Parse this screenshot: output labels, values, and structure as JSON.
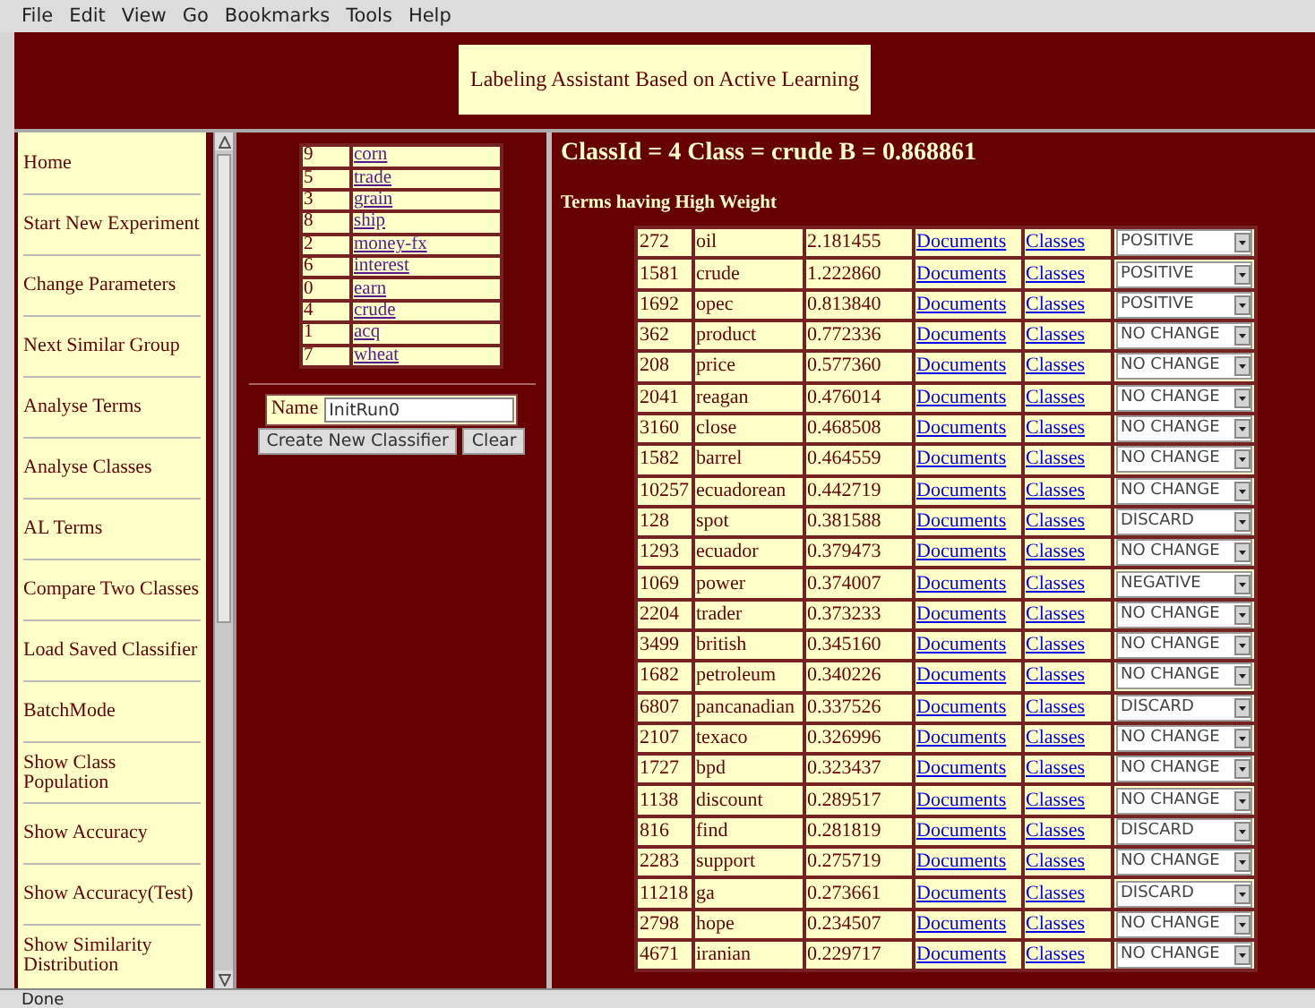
{
  "menu_bar": [
    "File",
    "Edit",
    "View",
    "Go",
    "Bookmarks",
    "Tools",
    "Help"
  ],
  "header": {
    "title": "Labeling Assistant Based on Active Learning"
  },
  "sidebar": {
    "items": [
      "Home",
      "Start New Experiment",
      "Change Parameters",
      "Next Similar Group",
      "Analyse Terms",
      "Analyse Classes",
      "AL Terms",
      "Compare Two Classes",
      "Load Saved Classifier",
      "BatchMode",
      "Show Class Population",
      "Show Accuracy",
      "Show Accuracy(Test)",
      "Show Similarity Distribution"
    ]
  },
  "classes": [
    {
      "id": "9",
      "name": "corn"
    },
    {
      "id": "5",
      "name": "trade"
    },
    {
      "id": "3",
      "name": "grain"
    },
    {
      "id": "8",
      "name": "ship"
    },
    {
      "id": "2",
      "name": "money-fx"
    },
    {
      "id": "6",
      "name": "interest"
    },
    {
      "id": "0",
      "name": "earn"
    },
    {
      "id": "4",
      "name": "crude"
    },
    {
      "id": "1",
      "name": "acq"
    },
    {
      "id": "7",
      "name": "wheat"
    }
  ],
  "classifier_form": {
    "name_label": "Name",
    "name_value": "InitRun0",
    "buttons": [
      "Create New Classifier",
      "Clear"
    ]
  },
  "heading": "ClassId = 4 Class = crude B = 0.868861",
  "subheading": "Terms having High Weight",
  "terms": [
    {
      "id": "272",
      "term": "oil",
      "weight": "2.181455",
      "documents": "Documents",
      "classes": "Classes",
      "action": "POSITIVE"
    },
    {
      "id": "1581",
      "term": "crude",
      "weight": "1.222860",
      "documents": "Documents",
      "classes": "Classes",
      "action": "POSITIVE"
    },
    {
      "id": "1692",
      "term": "opec",
      "weight": "0.813840",
      "documents": "Documents",
      "classes": "Classes",
      "action": "POSITIVE"
    },
    {
      "id": "362",
      "term": "product",
      "weight": "0.772336",
      "documents": "Documents",
      "classes": "Classes",
      "action": "NO CHANGE"
    },
    {
      "id": "208",
      "term": "price",
      "weight": "0.577360",
      "documents": "Documents",
      "classes": "Classes",
      "action": "NO CHANGE"
    },
    {
      "id": "2041",
      "term": "reagan",
      "weight": "0.476014",
      "documents": "Documents",
      "classes": "Classes",
      "action": "NO CHANGE"
    },
    {
      "id": "3160",
      "term": "close",
      "weight": "0.468508",
      "documents": "Documents",
      "classes": "Classes",
      "action": "NO CHANGE"
    },
    {
      "id": "1582",
      "term": "barrel",
      "weight": "0.464559",
      "documents": "Documents",
      "classes": "Classes",
      "action": "NO CHANGE"
    },
    {
      "id": "10257",
      "term": "ecuadorean",
      "weight": "0.442719",
      "documents": "Documents",
      "classes": "Classes",
      "action": "NO CHANGE"
    },
    {
      "id": "128",
      "term": "spot",
      "weight": "0.381588",
      "documents": "Documents",
      "classes": "Classes",
      "action": "DISCARD"
    },
    {
      "id": "1293",
      "term": "ecuador",
      "weight": "0.379473",
      "documents": "Documents",
      "classes": "Classes",
      "action": "NO CHANGE"
    },
    {
      "id": "1069",
      "term": "power",
      "weight": "0.374007",
      "documents": "Documents",
      "classes": "Classes",
      "action": "NEGATIVE"
    },
    {
      "id": "2204",
      "term": "trader",
      "weight": "0.373233",
      "documents": "Documents",
      "classes": "Classes",
      "action": "NO CHANGE"
    },
    {
      "id": "3499",
      "term": "british",
      "weight": "0.345160",
      "documents": "Documents",
      "classes": "Classes",
      "action": "NO CHANGE"
    },
    {
      "id": "1682",
      "term": "petroleum",
      "weight": "0.340226",
      "documents": "Documents",
      "classes": "Classes",
      "action": "NO CHANGE"
    },
    {
      "id": "6807",
      "term": "pancanadian",
      "weight": "0.337526",
      "documents": "Documents",
      "classes": "Classes",
      "action": "DISCARD"
    },
    {
      "id": "2107",
      "term": "texaco",
      "weight": "0.326996",
      "documents": "Documents",
      "classes": "Classes",
      "action": "NO CHANGE"
    },
    {
      "id": "1727",
      "term": "bpd",
      "weight": "0.323437",
      "documents": "Documents",
      "classes": "Classes",
      "action": "NO CHANGE"
    },
    {
      "id": "1138",
      "term": "discount",
      "weight": "0.289517",
      "documents": "Documents",
      "classes": "Classes",
      "action": "NO CHANGE"
    },
    {
      "id": "816",
      "term": "find",
      "weight": "0.281819",
      "documents": "Documents",
      "classes": "Classes",
      "action": "DISCARD"
    },
    {
      "id": "2283",
      "term": "support",
      "weight": "0.275719",
      "documents": "Documents",
      "classes": "Classes",
      "action": "NO CHANGE"
    },
    {
      "id": "11218",
      "term": "ga",
      "weight": "0.273661",
      "documents": "Documents",
      "classes": "Classes",
      "action": "DISCARD"
    },
    {
      "id": "2798",
      "term": "hope",
      "weight": "0.234507",
      "documents": "Documents",
      "classes": "Classes",
      "action": "NO CHANGE"
    },
    {
      "id": "4671",
      "term": "iranian",
      "weight": "0.229717",
      "documents": "Documents",
      "classes": "Classes",
      "action": "NO CHANGE"
    }
  ],
  "status_bar": "Done"
}
